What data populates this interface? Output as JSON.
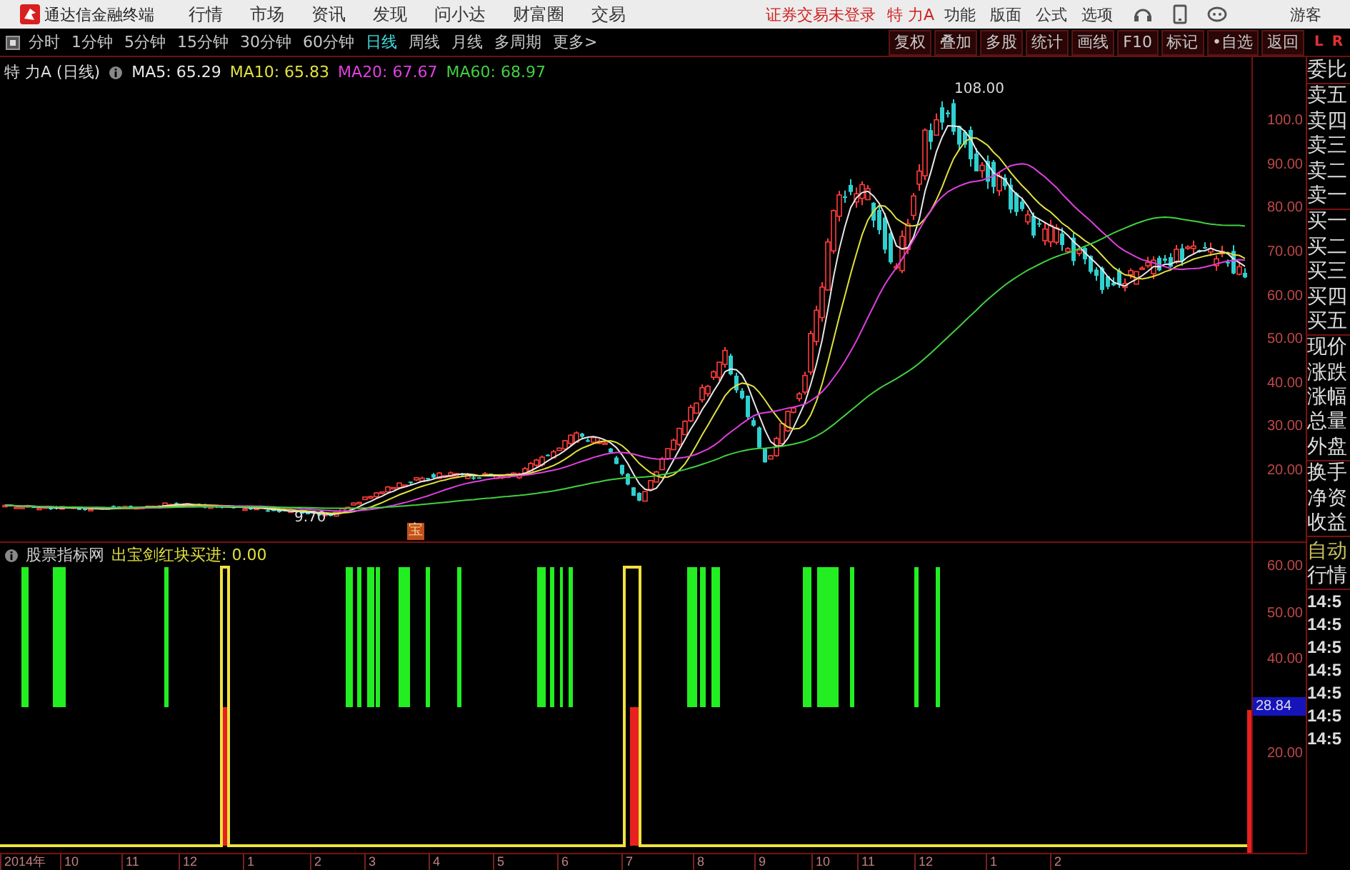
{
  "app": {
    "title": "通达信金融终端",
    "menu": [
      "行情",
      "市场",
      "资讯",
      "发现",
      "问小达",
      "财富圈",
      "交易"
    ],
    "login_status": "证券交易未登录",
    "stock_name": "特 力A",
    "actions": [
      "功能",
      "版面",
      "公式",
      "选项"
    ],
    "user": "游客"
  },
  "period_tabs": [
    {
      "label": "分时",
      "selected": false
    },
    {
      "label": "1分钟",
      "selected": false
    },
    {
      "label": "5分钟",
      "selected": false
    },
    {
      "label": "15分钟",
      "selected": false
    },
    {
      "label": "30分钟",
      "selected": false
    },
    {
      "label": "60分钟",
      "selected": false
    },
    {
      "label": "日线",
      "selected": true
    },
    {
      "label": "周线",
      "selected": false
    },
    {
      "label": "月线",
      "selected": false
    },
    {
      "label": "多周期",
      "selected": false
    },
    {
      "label": "更多>",
      "selected": false
    }
  ],
  "tools": [
    "复权",
    "叠加",
    "多股",
    "统计",
    "画线",
    "F10",
    "标记",
    "•自选",
    "返回"
  ],
  "corner_marks": [
    "L",
    "R"
  ],
  "price_chart": {
    "title": "特 力A (日线)",
    "ma": [
      {
        "label": "MA5: 65.29",
        "color": "#e8e8e8"
      },
      {
        "label": "MA10: 65.83",
        "color": "#e0e040"
      },
      {
        "label": "MA20: 67.67",
        "color": "#e040e0"
      },
      {
        "label": "MA60: 68.97",
        "color": "#40d040"
      }
    ],
    "high_label": "108.00",
    "low_label": "9.70",
    "signal_mark": "宝",
    "axis_labels": [
      "100.0",
      "90.00",
      "80.00",
      "70.00",
      "60.00",
      "50.00",
      "40.00",
      "30.00",
      "20.00"
    ]
  },
  "indicator": {
    "source": "股票指标网",
    "formula": "出宝剑红块买进: 0.00",
    "axis_labels": [
      "60.00",
      "50.00",
      "40.00",
      "20.00"
    ],
    "current_value": "28.84"
  },
  "x_axis": [
    "2014年",
    "10",
    "11",
    "12",
    "1",
    "2",
    "3",
    "4",
    "5",
    "6",
    "7",
    "8",
    "9",
    "10",
    "11",
    "12",
    "1",
    "2"
  ],
  "quote_panel": {
    "field_groups": [
      [
        "委比"
      ],
      [
        "卖五",
        "卖四",
        "卖三",
        "卖二",
        "卖一"
      ],
      [
        "买一",
        "买二",
        "买三",
        "买四",
        "买五"
      ],
      [
        "现价",
        "涨跌",
        "涨幅",
        "总量",
        "外盘"
      ],
      [
        "换手",
        "净资",
        "收益"
      ]
    ],
    "tabs": [
      "自动",
      "行情"
    ],
    "times": [
      "14:5",
      "14:5",
      "14:5",
      "14:5",
      "14:5",
      "14:5",
      "14:5"
    ]
  }
}
